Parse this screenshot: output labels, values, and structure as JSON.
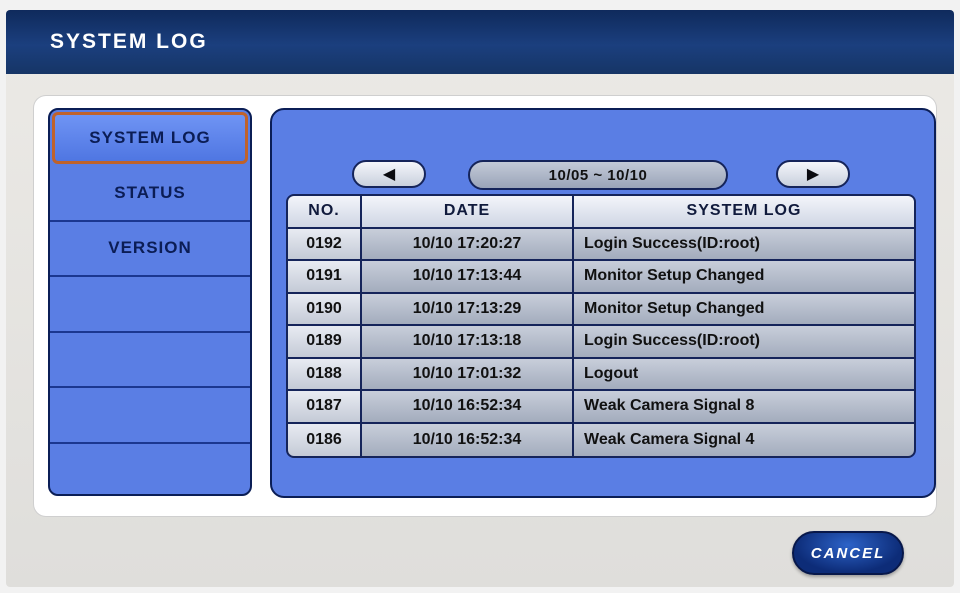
{
  "window": {
    "title": "SYSTEM LOG"
  },
  "sidebar": {
    "items": [
      {
        "label": "SYSTEM LOG"
      },
      {
        "label": "STATUS"
      },
      {
        "label": "VERSION"
      },
      {
        "label": ""
      },
      {
        "label": ""
      },
      {
        "label": ""
      },
      {
        "label": ""
      }
    ]
  },
  "nav": {
    "prev_icon": "triangle-left-icon",
    "next_icon": "triangle-right-icon",
    "prev_glyph": "◀",
    "next_glyph": "▶",
    "date_range": "10/05 ~ 10/10"
  },
  "table": {
    "headers": {
      "no": "NO.",
      "date": "DATE",
      "log": "SYSTEM LOG"
    },
    "rows": [
      {
        "no": "0192",
        "date": "10/10 17:20:27",
        "log": "Login Success(ID:root)"
      },
      {
        "no": "0191",
        "date": "10/10 17:13:44",
        "log": "Monitor Setup Changed"
      },
      {
        "no": "0190",
        "date": "10/10 17:13:29",
        "log": "Monitor Setup Changed"
      },
      {
        "no": "0189",
        "date": "10/10 17:13:18",
        "log": "Login Success(ID:root)"
      },
      {
        "no": "0188",
        "date": "10/10 17:01:32",
        "log": "Logout"
      },
      {
        "no": "0187",
        "date": "10/10 16:52:34",
        "log": "Weak Camera Signal 8"
      },
      {
        "no": "0186",
        "date": "10/10 16:52:34",
        "log": "Weak Camera Signal 4"
      }
    ]
  },
  "footer": {
    "cancel_label": "CANCEL"
  },
  "colors": {
    "title_bar": "#163566",
    "panel_blue": "#5a7ee4",
    "active_border": "#c0622a",
    "cancel_blue": "#0d2c78"
  }
}
